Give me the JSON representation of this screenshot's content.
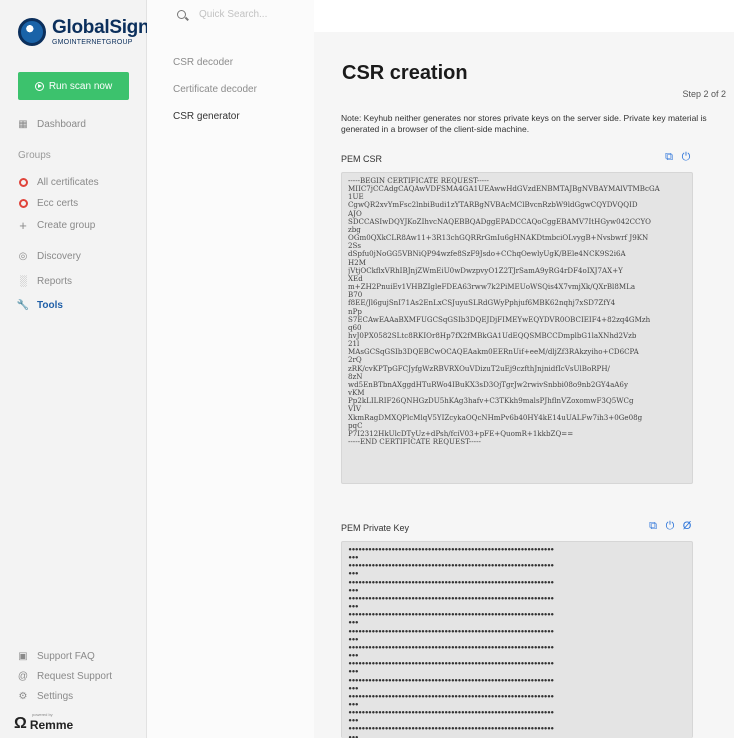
{
  "brand": {
    "name": "GlobalSign.",
    "sub": "GMOINTERNETGROUP"
  },
  "sidebar": {
    "run_button": "Run scan now",
    "dashboard": "Dashboard",
    "groups_heading": "Groups",
    "groups": [
      "All certificates",
      "Ecc certs",
      "Create group"
    ],
    "items": [
      "Discovery",
      "Reports",
      "Tools"
    ],
    "bottom": [
      "Support FAQ",
      "Request Support",
      "Settings"
    ],
    "powered": "powered by",
    "remme": "Remme"
  },
  "search": {
    "placeholder": "Quick Search..."
  },
  "subnav": {
    "items": [
      "CSR decoder",
      "Certificate decoder",
      "CSR generator"
    ]
  },
  "main": {
    "title": "CSR creation",
    "step": "Step 2 of 2",
    "note": "Note: Keyhub neither generates nor stores private keys on the server side. Private key material is generated in a browser of the client-side machine.",
    "csr_label": "PEM CSR",
    "key_label": "PEM Private Key",
    "csr_text": "-----BEGIN CERTIFICATE REQUEST-----\nMIIC7jCCAdgCAQAwVDFSMA4GA1UEAwwHdGVzdENBMTAJBgNVBAYMAlVTMBcGA\n1UE\nCgwQR2xvYmFsc2lnbiBudi1zYTARBgNVBAcMClBvcnRzbW9ldGgwCQYDVQQID\nAJO\nSDCCASIwDQYJKoZIhvcNAQEBBQADggEPADCCAQoCggEBAMV7ItHGyw042CCYO\nzbg\nOGm0QXkCLR8Aw11+3R13chGQRRrGmIu6gHNAKDtmbciOLvygB+Nvsbwrf J9KN\n2Ss\ndSpfu0jNoGG5VBNiQP94wzfe8SzF9Jsdo+CChqOewlyUgK/BEle4NCK9S2i6A\nH2M\njVtjOCkflxVRhIBJnjZWmEiU0wDwzpvyO1Z2TJrSamA9yRG4rDF4oIXJ7AX+Y\nXEd\nm+ZH2PnuiEv1VHBZIgleFDEA63rww7k2PiMEUoWSQis4X7vmjXk/QXrBl8MLa\nB70\nf8EE/Jl6gujSnI71As2EnLxCSJuyuSLRdGWyPphjuf6MBK62nqhj7xSD7ZfY4\nnPp\nS7ECAwEAAaBXMFUGCSqGSIb3DQEJDjFIMEYwEQYDVR0OBCIEIF4+82zq4GMzh\nq60\nhvJ0PX0582SLtc8RKIOr8Hp7fX2fMBkGA1UdEQQSMBCCDmplbG1laXNhd2Vzb\n21l\nMAsGCSqGSIb3DQEBCwOCAQEAakm0EERnUif+eeM/dljZf3RAkzyiho+CD6CPA\n2rQ\nzRK/cvKPTpGFCJyfgWzRBVRXOuVDizuT2uEj9czfthJnjnidfIcVsUlBoRPH/\n8zN\nwd5EnBTbnAXggdHTuRWo4IBuKX3sD3OjTgrJw2rwivSnbbi08o9nb2GY4aA6y\nvKM\nPp2kLILRIF26QNHGzDU5hKAg3hafv+C3TKkh9malsPJhflnVZoxomwF3Q5WCg\nVIV\nXkmRagDMXQPlcMlqV5YIZcykaOQcNHmPv6b40HY4kE14uUALFw7ih3+0Ge08g\npqC\nP7I2312HkUlcDTyUz+dPsh/fciV03+pFE+QuomR+1kkbZQ==\n-----END CERTIFICATE REQUEST-----"
  }
}
